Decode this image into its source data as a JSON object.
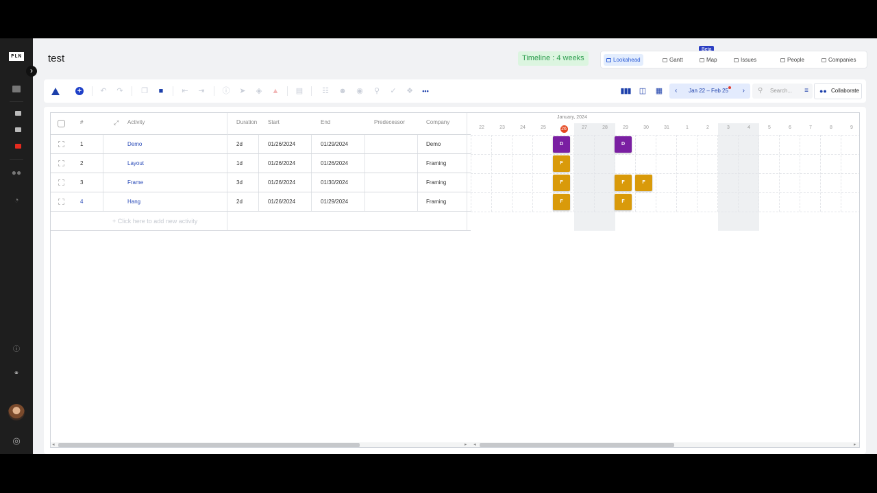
{
  "sidebar": {
    "logo_text": "PLN",
    "expand_icon": "chevron-right-icon"
  },
  "header": {
    "title": "test",
    "timeline_badge": "Timeline : 4 weeks",
    "views": [
      {
        "label": "Lookahead",
        "icon": "lookahead-icon",
        "active": true
      },
      {
        "label": "Gantt",
        "icon": "gantt-icon",
        "active": false
      },
      {
        "label": "Map",
        "icon": "map-icon",
        "active": false
      },
      {
        "label": "Issues",
        "icon": "issues-icon",
        "active": false
      },
      {
        "label": "People",
        "icon": "people-icon",
        "active": false
      },
      {
        "label": "Companies",
        "icon": "companies-icon",
        "active": false
      }
    ],
    "beta_label": "Beta"
  },
  "toolbar": {
    "date_range": "Jan 22 – Feb 25",
    "search_placeholder": "Search...",
    "collaborate_label": "Collaborate",
    "more_icon": "•••"
  },
  "table": {
    "headers": {
      "num": "#",
      "activity": "Activity",
      "duration": "Duration",
      "start": "Start",
      "end": "End",
      "predecessor": "Predecessor",
      "company": "Company"
    },
    "rows": [
      {
        "num": "1",
        "activity": "Demo",
        "duration": "2d",
        "start": "01/26/2024",
        "end": "01/29/2024",
        "predecessor": "",
        "company": "Demo"
      },
      {
        "num": "2",
        "activity": "Layout",
        "duration": "1d",
        "start": "01/26/2024",
        "end": "01/26/2024",
        "predecessor": "",
        "company": "Framing"
      },
      {
        "num": "3",
        "activity": "Frame",
        "duration": "3d",
        "start": "01/26/2024",
        "end": "01/30/2024",
        "predecessor": "",
        "company": "Framing"
      },
      {
        "num": "4",
        "activity": "Hang",
        "duration": "2d",
        "start": "01/26/2024",
        "end": "01/29/2024",
        "predecessor": "",
        "company": "Framing"
      }
    ],
    "add_row_label": "+ Click here to add new activity"
  },
  "gantt": {
    "month_label": "January, 2024",
    "days": [
      "22",
      "23",
      "24",
      "25",
      "26",
      "27",
      "28",
      "29",
      "30",
      "31",
      "1",
      "2",
      "3",
      "4",
      "5",
      "6",
      "7",
      "8",
      "9"
    ],
    "today_index": 4,
    "weekend_indices": [
      5,
      6,
      12,
      13
    ],
    "colors": {
      "demo": "#7a1fa2",
      "framing": "#d99a0a",
      "today": "#e54720"
    },
    "bars": [
      {
        "row": 0,
        "day_index": 4,
        "label": "D",
        "color": "#7a1fa2"
      },
      {
        "row": 0,
        "day_index": 7,
        "label": "D",
        "color": "#7a1fa2"
      },
      {
        "row": 1,
        "day_index": 4,
        "label": "F",
        "color": "#d99a0a"
      },
      {
        "row": 2,
        "day_index": 4,
        "label": "F",
        "color": "#d99a0a"
      },
      {
        "row": 2,
        "day_index": 7,
        "label": "F",
        "color": "#d99a0a"
      },
      {
        "row": 2,
        "day_index": 8,
        "label": "F",
        "color": "#d99a0a"
      },
      {
        "row": 3,
        "day_index": 4,
        "label": "F",
        "color": "#d99a0a"
      },
      {
        "row": 3,
        "day_index": 7,
        "label": "F",
        "color": "#d99a0a"
      }
    ]
  }
}
